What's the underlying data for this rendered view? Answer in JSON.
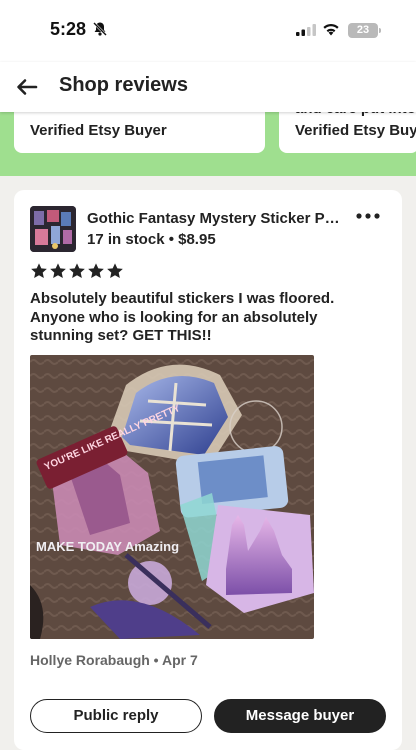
{
  "status": {
    "time": "5:28",
    "battery": "23",
    "icons": [
      "bell-slash-icon",
      "cell-signal-icon",
      "wifi-icon",
      "battery-icon"
    ]
  },
  "header": {
    "title": "Shop reviews",
    "back_icon": "arrow-left-icon"
  },
  "carousel": {
    "cards": [
      {
        "buyer": "Verified Etsy Buyer"
      },
      {
        "partial_text": "and care put into",
        "buyer": "Verified Etsy Buye"
      }
    ]
  },
  "review": {
    "item_title": "Gothic Fantasy Mystery  Sticker Pa...",
    "item_meta": "17 in stock • $8.95",
    "rating": 5,
    "text": "Absolutely beautiful stickers I was floored. Anyone who is looking for an absolutely stunning set? GET THIS!!",
    "photo_text": [
      "YOU'RE LIKE REALLY PRETTY",
      "MAKE TODAY Amazing"
    ],
    "byline": "Hollye Rorabaugh • Apr 7",
    "public_reply_label": "Public reply",
    "message_buyer_label": "Message buyer"
  },
  "colors": {
    "accent_green": "#9fdf8f",
    "dark_button": "#222222",
    "background": "#f1f0ed"
  }
}
